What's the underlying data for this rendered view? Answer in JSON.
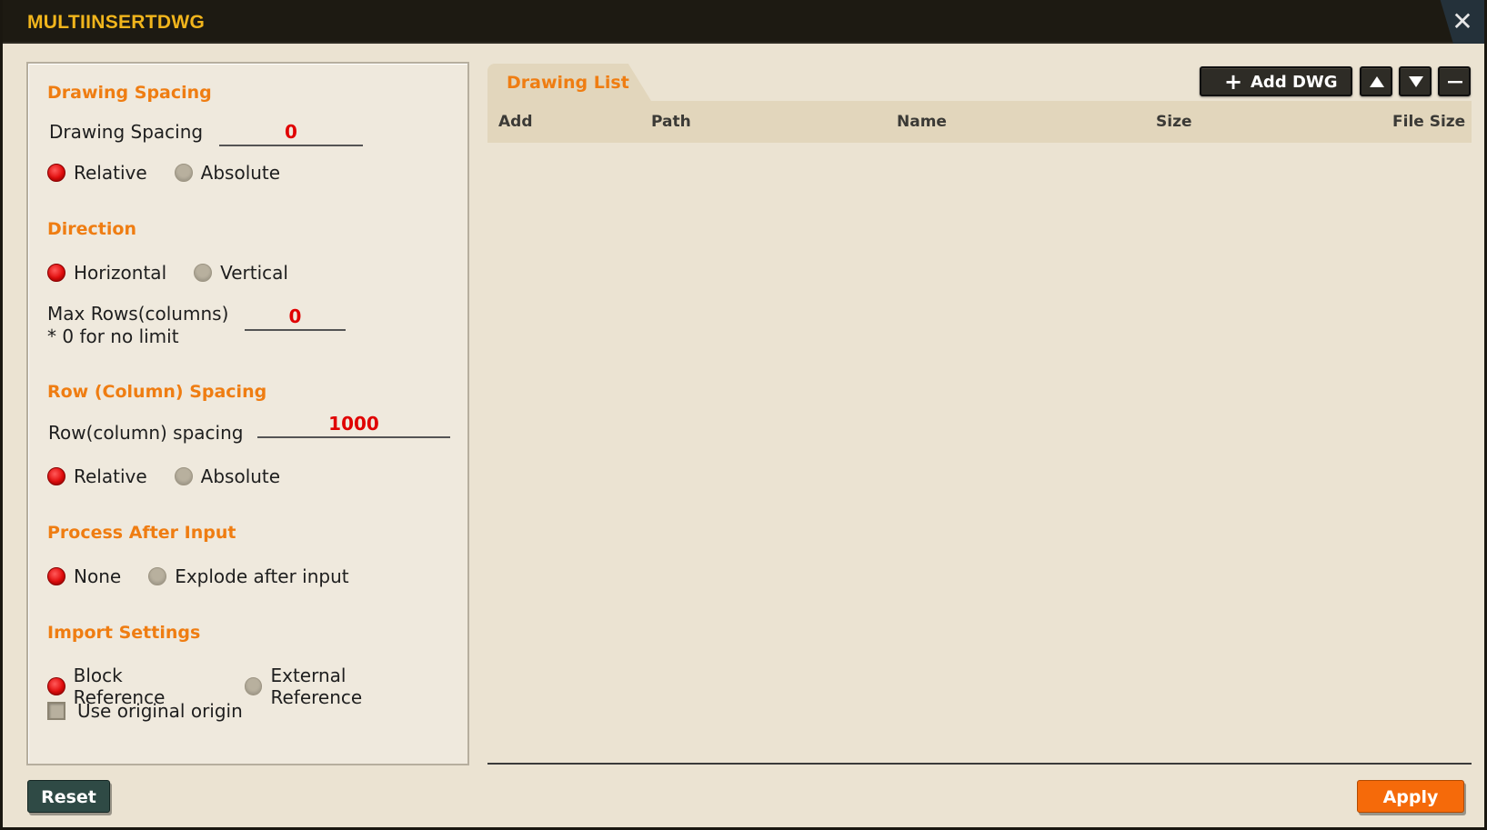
{
  "window": {
    "title": "MULTIINSERTDWG",
    "close_icon": "close-icon"
  },
  "left": {
    "drawing_spacing": {
      "title": "Drawing Spacing",
      "label": "Drawing Spacing",
      "value": "0",
      "options": [
        "Relative",
        "Absolute"
      ],
      "selected": "Relative"
    },
    "direction": {
      "title": "Direction",
      "options": [
        "Horizontal",
        "Vertical"
      ],
      "selected": "Horizontal",
      "max_rows_label": "Max Rows(columns)",
      "max_rows_note": "* 0 for no limit",
      "max_rows_value": "0"
    },
    "row_spacing": {
      "title": "Row (Column) Spacing",
      "label": "Row(column) spacing",
      "value": "1000",
      "options": [
        "Relative",
        "Absolute"
      ],
      "selected": "Relative"
    },
    "process_after_input": {
      "title": "Process After Input",
      "options": [
        "None",
        "Explode after input"
      ],
      "selected": "None"
    },
    "import_settings": {
      "title": "Import Settings",
      "options": [
        "Block Reference",
        "External Reference"
      ],
      "selected": "Block Reference",
      "use_original_origin_label": "Use original origin",
      "use_original_origin_checked": false
    }
  },
  "right": {
    "tab_label": "Drawing List",
    "add_button_label": "Add DWG",
    "columns": [
      "Add",
      "Path",
      "Name",
      "Size",
      "File Size"
    ],
    "rows": []
  },
  "footer": {
    "reset_label": "Reset",
    "apply_label": "Apply"
  },
  "colors": {
    "accent": "#ef7d12",
    "value_red": "#e00000",
    "title_yellow": "#f1b51c",
    "apply_orange": "#f56a0a",
    "reset_green": "#2f4a45"
  }
}
